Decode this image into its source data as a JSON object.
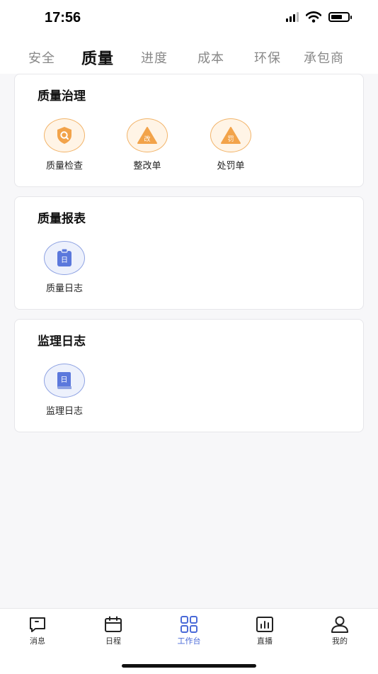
{
  "status": {
    "time": "17:56"
  },
  "tabs": [
    {
      "label": "安全"
    },
    {
      "label": "质量"
    },
    {
      "label": "进度"
    },
    {
      "label": "成本"
    },
    {
      "label": "环保"
    },
    {
      "label": "承包商"
    }
  ],
  "active_tab": "质量",
  "sections": {
    "governance": {
      "title": "质量治理",
      "items": [
        {
          "label": "质量检查",
          "icon": "search-shield-icon"
        },
        {
          "label": "整改单",
          "icon": "rectify-icon",
          "badge": "改"
        },
        {
          "label": "处罚单",
          "icon": "penalty-icon",
          "badge": "罚"
        }
      ]
    },
    "report": {
      "title": "质量报表",
      "items": [
        {
          "label": "质量日志",
          "icon": "calendar-log-icon",
          "badge": "日"
        }
      ]
    },
    "supervision": {
      "title": "监理日志",
      "items": [
        {
          "label": "监理日志",
          "icon": "book-log-icon",
          "badge": "日"
        }
      ]
    }
  },
  "bottom_nav": [
    {
      "label": "消息",
      "icon": "message-icon"
    },
    {
      "label": "日程",
      "icon": "calendar-icon"
    },
    {
      "label": "工作台",
      "icon": "grid-icon"
    },
    {
      "label": "直播",
      "icon": "live-chart-icon"
    },
    {
      "label": "我的",
      "icon": "user-icon"
    }
  ],
  "active_nav": "工作台",
  "colors": {
    "accent": "#4a6ad8",
    "orange": "#f2a34a"
  }
}
